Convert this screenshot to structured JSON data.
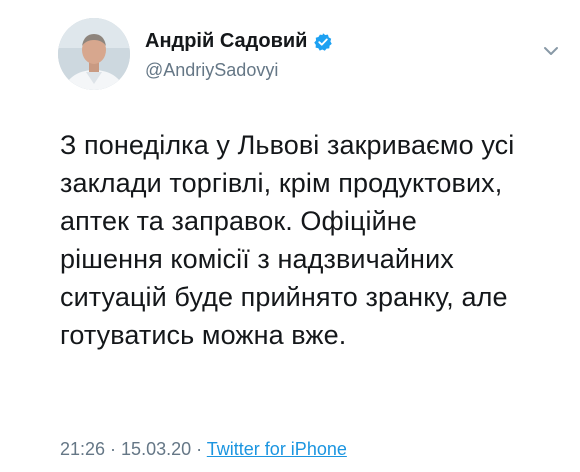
{
  "author": {
    "name": "Андрій Садовий",
    "handle": "@AndriySadovyi"
  },
  "icons": {
    "verified": "verified-badge-icon",
    "caret": "chevron-down-icon",
    "avatar": "profile-photo"
  },
  "colors": {
    "verified": "#1da1f2",
    "link": "#1b95e0",
    "secondary_text": "#657786"
  },
  "tweet": {
    "lines": [
      "З понеділка у Львові закриваємо усі",
      "заклади торгівлі, крім продуктових,",
      "аптек та заправок. Офіційне",
      "рішення комісії з надзвичайних",
      "ситуацій буде прийнято зранку, але",
      "готуватись можна вже."
    ]
  },
  "meta": {
    "time": "21:26",
    "separator1": " · ",
    "date": "15.03.20",
    "separator2": " · ",
    "source": "Twitter for iPhone"
  }
}
